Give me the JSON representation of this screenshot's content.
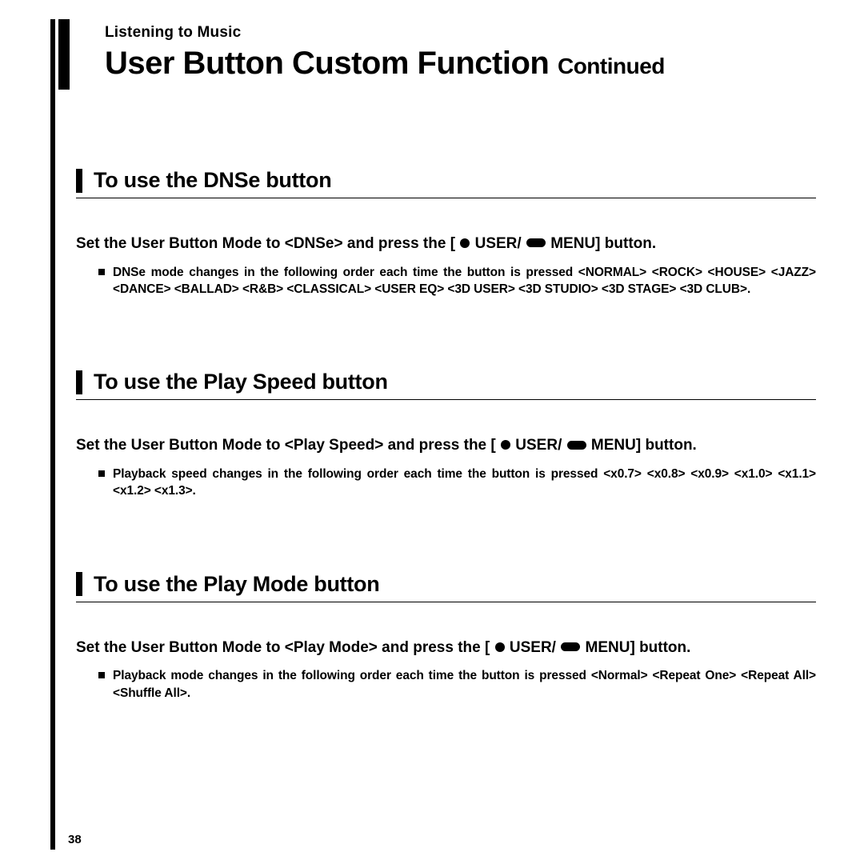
{
  "header": {
    "chapter": "Listening to Music",
    "title_main": "User Button Custom Function",
    "title_sub": "Continued"
  },
  "icons": {
    "dot_label": "USER/",
    "bar_label": " MENU] button."
  },
  "sections": [
    {
      "title": "To use the DNSe button",
      "instruction_pre": "Set the User Button Mode to <DNSe> and press the [",
      "instruction_mid": " USER/",
      "instruction_post": " MENU] button.",
      "bullet": "DNSe mode changes in the following order each time the button is pressed <NORMAL> <ROCK> <HOUSE> <JAZZ> <DANCE> <BALLAD> <R&B> <CLASSICAL> <USER EQ> <3D USER> <3D STUDIO> <3D STAGE> <3D CLUB>."
    },
    {
      "title": "To use the Play Speed button",
      "instruction_pre": "Set the User Button Mode to <Play Speed> and press the [",
      "instruction_mid": " USER/",
      "instruction_post": " MENU] button.",
      "bullet": "Playback speed changes in the following order each time the button is pressed <x0.7> <x0.8> <x0.9> <x1.0> <x1.1> <x1.2> <x1.3>."
    },
    {
      "title": "To use the Play Mode button",
      "instruction_pre": "Set the User Button Mode to <Play Mode> and press the [",
      "instruction_mid": " USER/",
      "instruction_post": " MENU] button.",
      "bullet": "Playback mode changes in the following order each time the button is pressed <Normal> <Repeat One> <Repeat All> <Shuffle All>."
    }
  ],
  "page_number": "38"
}
